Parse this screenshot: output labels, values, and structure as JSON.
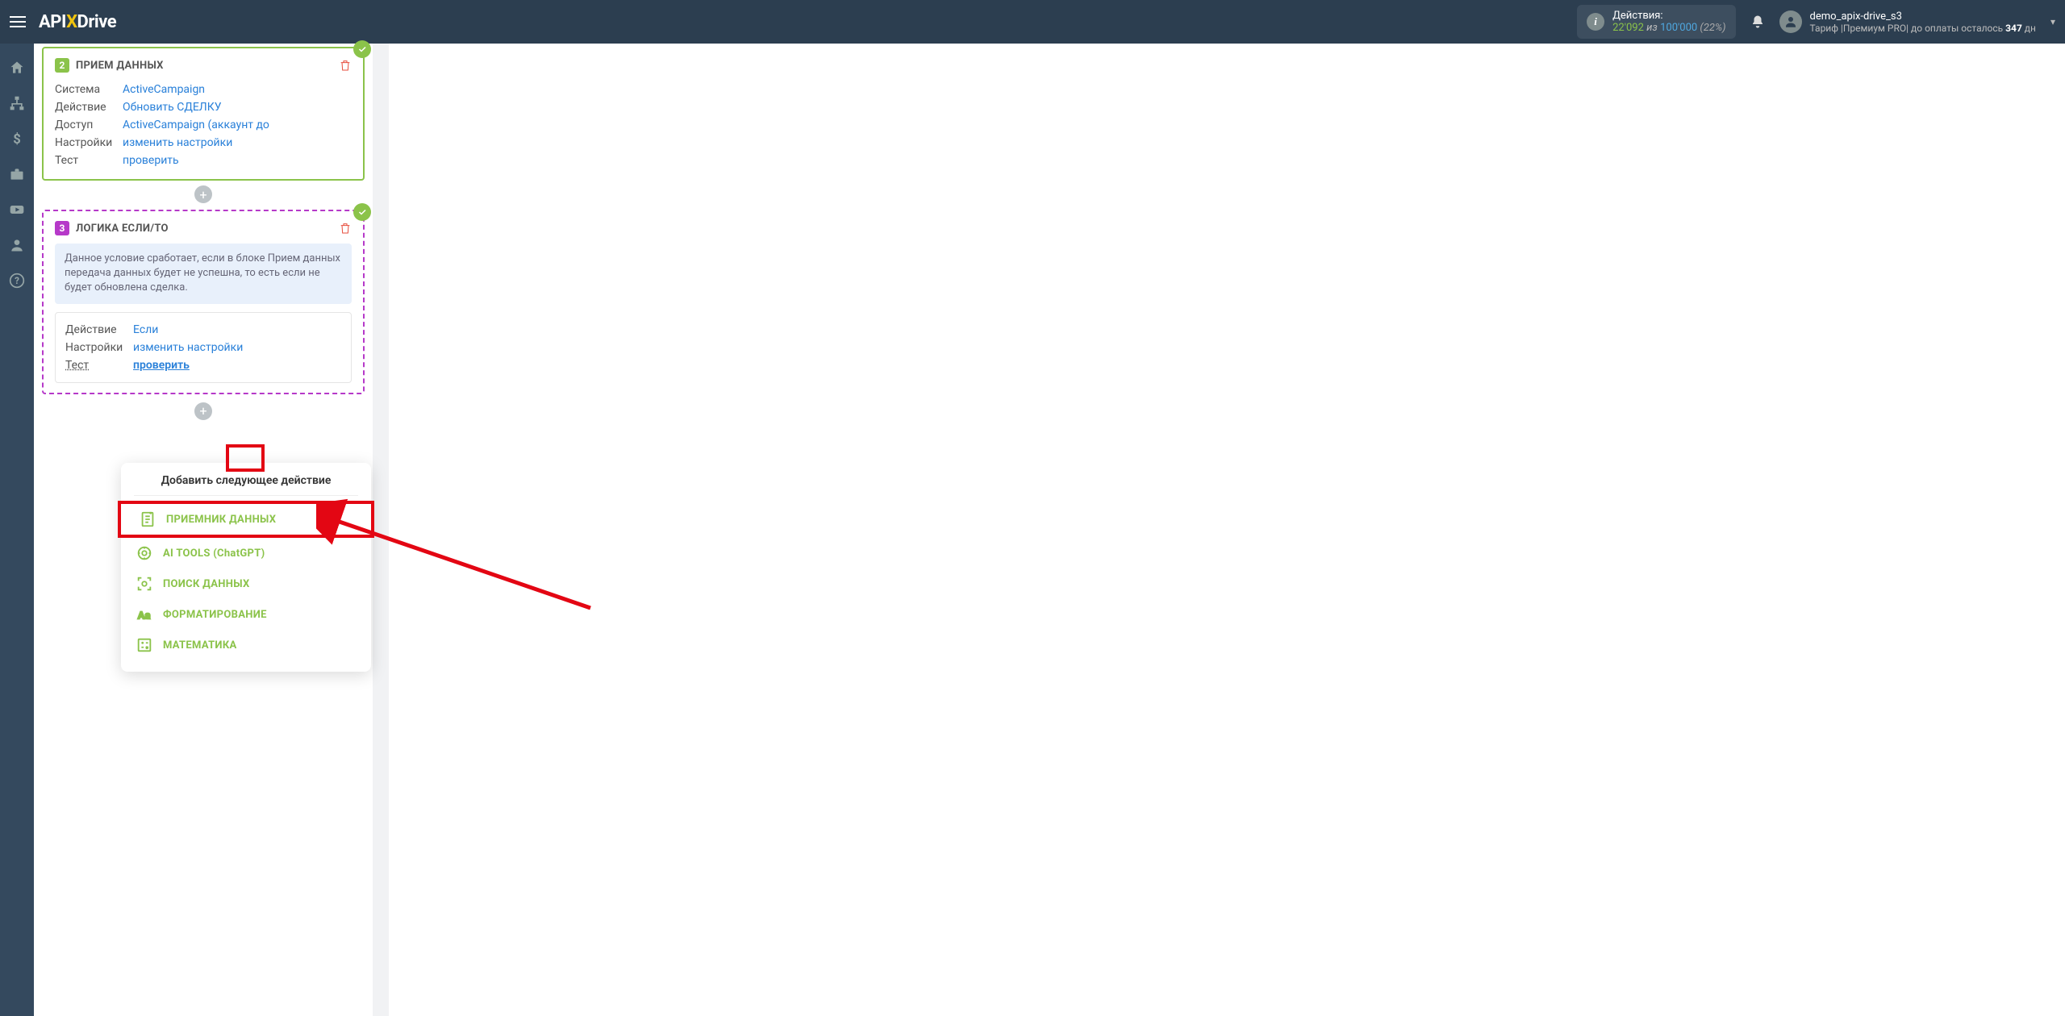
{
  "brand": {
    "pre": "API",
    "x": "X",
    "post": "Drive"
  },
  "top": {
    "actions_label": "Действия:",
    "actions_used": "22'092",
    "actions_sep": "из",
    "actions_max": "100'000",
    "actions_pct": "(22%)",
    "username": "demo_apix-drive_s3",
    "tariff_pre": "Тариф |Премиум PRO| до оплаты осталось ",
    "tariff_days": "347",
    "tariff_post": " дн"
  },
  "card2": {
    "num": "2",
    "title": "ПРИЕМ ДАННЫХ",
    "rows": {
      "system_k": "Система",
      "system_v": "ActiveCampaign",
      "action_k": "Действие",
      "action_v": "Обновить СДЕЛКУ",
      "access_k": "Доступ",
      "access_v": "ActiveCampaign (аккаунт до",
      "settings_k": "Настройки",
      "settings_v": "изменить настройки",
      "test_k": "Тест",
      "test_v": "проверить"
    }
  },
  "card3": {
    "num": "3",
    "title": "ЛОГИКА ЕСЛИ/ТО",
    "info": "Данное условие сработает, если в блоке Прием данных передача данных будет не успешна, то есть если не будет обновлена сделка.",
    "rows": {
      "action_k": "Действие",
      "action_v": "Если",
      "settings_k": "Настройки",
      "settings_v": "изменить настройки",
      "test_k": "Тест",
      "test_v": "проверить"
    }
  },
  "popup": {
    "title": "Добавить следующее действие",
    "items": [
      "ПРИЕМНИК ДАННЫХ",
      "AI TOOLS (ChatGPT)",
      "ПОИСК ДАННЫХ",
      "ФОРМАТИРОВАНИЕ",
      "МАТЕМАТИКА"
    ]
  }
}
